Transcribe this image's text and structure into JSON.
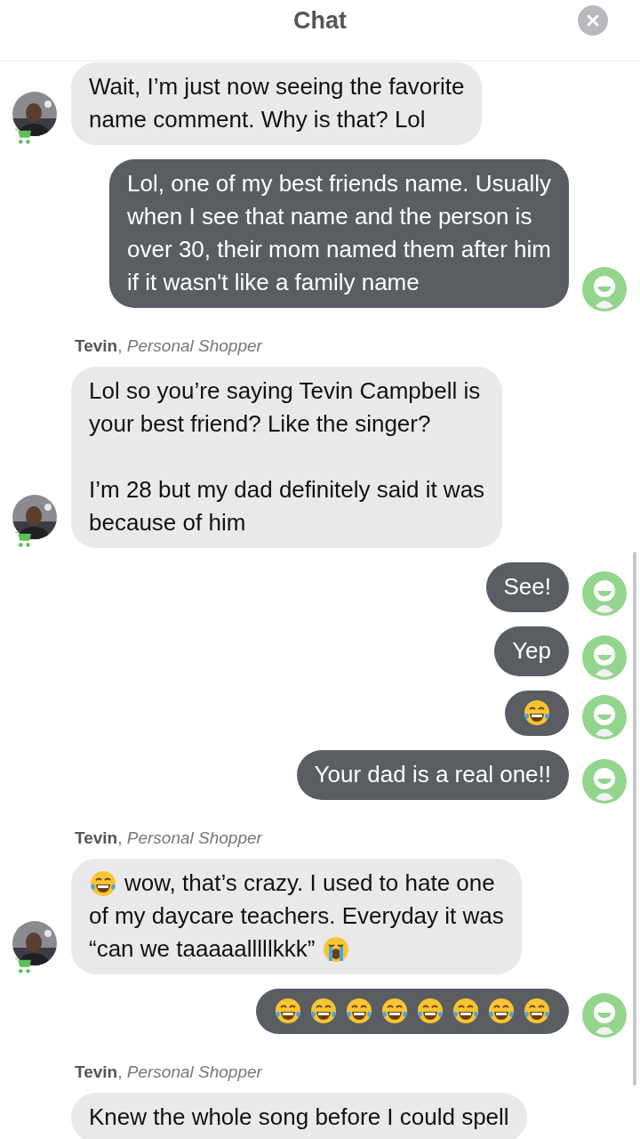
{
  "header": {
    "title": "Chat"
  },
  "messages": [
    {
      "kind": "incoming",
      "avatar": true,
      "paragraphs": [
        [
          [
            {
              "kind": "text",
              "text": "Wait, I’m just now seeing the favorite"
            }
          ],
          [
            {
              "kind": "text",
              "text": "name comment.  Why is that? Lol"
            }
          ]
        ]
      ]
    },
    {
      "kind": "outgoing",
      "avatar": true,
      "paragraphs": [
        [
          [
            {
              "kind": "text",
              "text": "Lol, one of my best friends name. Usually"
            }
          ],
          [
            {
              "kind": "text",
              "text": "when I see that name and the person is"
            }
          ],
          [
            {
              "kind": "text",
              "text": "over 30, their mom named them after him"
            }
          ],
          [
            {
              "kind": "text",
              "text": "if it wasn't like a family name"
            }
          ]
        ]
      ]
    },
    {
      "kind": "sender",
      "label": "**Tevin**, *Personal Shopper*"
    },
    {
      "kind": "incoming",
      "avatar": true,
      "paragraphs": [
        [
          [
            {
              "kind": "text",
              "text": "Lol so you’re saying Tevin Campbell is"
            }
          ],
          [
            {
              "kind": "text",
              "text": "your best friend? Like the singer?"
            }
          ]
        ],
        [
          [
            {
              "kind": "text",
              "text": "I’m 28 but my dad definitely said it was"
            }
          ],
          [
            {
              "kind": "text",
              "text": "because of him"
            }
          ]
        ]
      ]
    },
    {
      "kind": "outgoing",
      "avatar": true,
      "paragraphs": [
        [
          [
            {
              "kind": "text",
              "text": "See!"
            }
          ]
        ]
      ]
    },
    {
      "kind": "outgoing",
      "avatar": true,
      "paragraphs": [
        [
          [
            {
              "kind": "text",
              "text": "Yep"
            }
          ]
        ]
      ]
    },
    {
      "kind": "outgoing",
      "avatar": true,
      "paragraphs": [
        [
          [
            {
              "kind": "laugh"
            }
          ]
        ]
      ]
    },
    {
      "kind": "outgoing",
      "avatar": true,
      "paragraphs": [
        [
          [
            {
              "kind": "text",
              "text": "Your dad is a real one!!"
            }
          ]
        ]
      ]
    },
    {
      "kind": "sender",
      "label": "**Tevin**, *Personal Shopper*"
    },
    {
      "kind": "incoming",
      "avatar": true,
      "paragraphs": [
        [
          [
            {
              "kind": "laugh"
            },
            {
              "kind": "text",
              "text": "wow, that’s crazy. I used to hate one"
            }
          ],
          [
            {
              "kind": "text",
              "text": "of my daycare teachers. Everyday it was"
            }
          ],
          [
            {
              "kind": "text",
              "text": "“can we taaaaalllllkkk”"
            },
            {
              "kind": "cry"
            }
          ]
        ]
      ]
    },
    {
      "kind": "outgoing",
      "avatar": true,
      "paragraphs": [
        [
          [
            {
              "kind": "laugh"
            },
            {
              "kind": "laugh"
            },
            {
              "kind": "laugh"
            },
            {
              "kind": "laugh"
            },
            {
              "kind": "laugh"
            },
            {
              "kind": "laugh"
            },
            {
              "kind": "laugh"
            },
            {
              "kind": "laugh"
            }
          ]
        ]
      ]
    },
    {
      "kind": "sender",
      "label": "**Tevin**, *Personal Shopper*"
    },
    {
      "kind": "incoming",
      "avatar": false,
      "paragraphs": [
        [
          [
            {
              "kind": "text",
              "text": "Knew the whole song before I could spell"
            }
          ]
        ]
      ]
    }
  ]
}
